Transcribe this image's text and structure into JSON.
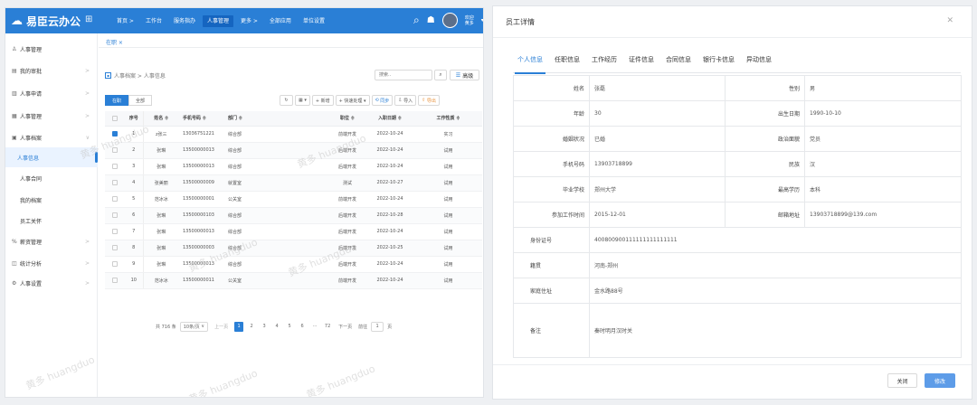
{
  "app": {
    "name": "易臣云办公",
    "welcome": "欢迎\n黄多"
  },
  "topnav": [
    "首页 >",
    "工作台",
    "服务指办",
    "人事管理",
    "更多 >",
    "全部应用",
    "单位设置"
  ],
  "sidebar": [
    {
      "icon": "♙",
      "label": "人事管理",
      "arrow": ""
    },
    {
      "icon": "▤",
      "label": "我的审批",
      "arrow": ">"
    },
    {
      "icon": "▥",
      "label": "人事申请",
      "arrow": ">"
    },
    {
      "icon": "▦",
      "label": "人事管理",
      "arrow": ">"
    },
    {
      "icon": "▣",
      "label": "人事档案",
      "arrow": "∨"
    },
    {
      "icon": "",
      "label": "人事信息",
      "arrow": ""
    },
    {
      "icon": "",
      "label": "人事合同",
      "arrow": ""
    },
    {
      "icon": "",
      "label": "我的档案",
      "arrow": ""
    },
    {
      "icon": "",
      "label": "员工关怀",
      "arrow": ""
    },
    {
      "icon": "%",
      "label": "薪资管理",
      "arrow": ">"
    },
    {
      "icon": "◫",
      "label": "统计分析",
      "arrow": ">"
    },
    {
      "icon": "⚙",
      "label": "人事设置",
      "arrow": ">"
    }
  ],
  "page_tab": "在职 ×",
  "breadcrumb": "人事档案  >  人事信息",
  "search": {
    "placeholder": "搜索..",
    "adv": "高级"
  },
  "seg": [
    "在职",
    "全部"
  ],
  "tools": [
    "↻",
    "▦ ▾",
    "+ 新增",
    "+ 快速处理 ▾",
    "同步",
    "导入",
    "导出"
  ],
  "table": {
    "headers": [
      "",
      "序号",
      "姓名 ≑",
      "手机号码 ≑",
      "部门 ≑",
      "",
      "职位 ≑",
      "入职日期 ≑",
      "工作性质 ≑"
    ],
    "rows": [
      [
        "✓",
        "1",
        "z张三",
        "13036751221",
        "综合部",
        "",
        "前端开发",
        "2022-10-24",
        "实习"
      ],
      [
        "",
        "2",
        "张琳",
        "13500000013",
        "综合部",
        "",
        "后端开发",
        "2022-10-24",
        "试用"
      ],
      [
        "",
        "3",
        "张琳",
        "13500000013",
        "综合部",
        "",
        "后端开发",
        "2022-10-24",
        "试用"
      ],
      [
        "",
        "4",
        "张美丽",
        "13500000009",
        "就置室",
        "",
        "测试",
        "2022-10-27",
        "试用"
      ],
      [
        "",
        "5",
        "范冰冰",
        "13500000001",
        "公关室",
        "",
        "前端开发",
        "2022-10-24",
        "试用"
      ],
      [
        "",
        "6",
        "张琳",
        "13500000103",
        "综合部",
        "",
        "后端开发",
        "2022-10-28",
        "试用"
      ],
      [
        "",
        "7",
        "张琳",
        "13500000013",
        "综合部",
        "",
        "后端开发",
        "2022-10-24",
        "试用"
      ],
      [
        "",
        "8",
        "张琳",
        "13500000003",
        "综合部",
        "",
        "后端开发",
        "2022-10-25",
        "试用"
      ],
      [
        "",
        "9",
        "张琳",
        "13500000013",
        "综合部",
        "",
        "后端开发",
        "2022-10-24",
        "试用"
      ],
      [
        "",
        "10",
        "范冰冰",
        "13500000011",
        "公关室",
        "",
        "前端开发",
        "2022-10-24",
        "试用"
      ]
    ]
  },
  "pager": {
    "total": "共 716 条",
    "size": "10条/页",
    "prev": "上一页",
    "pages": [
      "1",
      "2",
      "3",
      "4",
      "5",
      "6",
      "···",
      "72"
    ],
    "next": "下一页",
    "goto": "前往",
    "page": "1",
    "unit": "页"
  },
  "watermark": "黄多 huangduo",
  "dialog": {
    "title": "员工详情",
    "tabs": [
      "个人信息",
      "任职信息",
      "工作经历",
      "证件信息",
      "合同信息",
      "银行卡信息",
      "异动信息"
    ],
    "fields": [
      [
        "姓名",
        "张磊",
        "性别",
        "男"
      ],
      [
        "年龄",
        "30",
        "出生日期",
        "1990-10-10"
      ],
      [
        "婚姻状况",
        "已婚",
        "政治面貌",
        "党员"
      ],
      [
        "手机号码",
        "13903718899",
        "民族",
        "汉"
      ],
      [
        "毕业学校",
        "郑州大学",
        "最高学历",
        "本科"
      ],
      [
        "参加工作时间",
        "2015-12-01",
        "邮箱地址",
        "13903718899@139.com"
      ]
    ],
    "wide": [
      [
        "身份证号",
        "400800900111111111111111"
      ],
      [
        "籍贯",
        "河南-郑州"
      ],
      [
        "家庭住址",
        "金水路88号"
      ],
      [
        "备注",
        "秦时明月汉时关"
      ]
    ],
    "close_btn": "关闭",
    "edit_btn": "修改"
  },
  "colors": {
    "brand": "#2a7fd6",
    "topbar": "#2a7fd6",
    "primary_button": "#5d9ce8"
  }
}
